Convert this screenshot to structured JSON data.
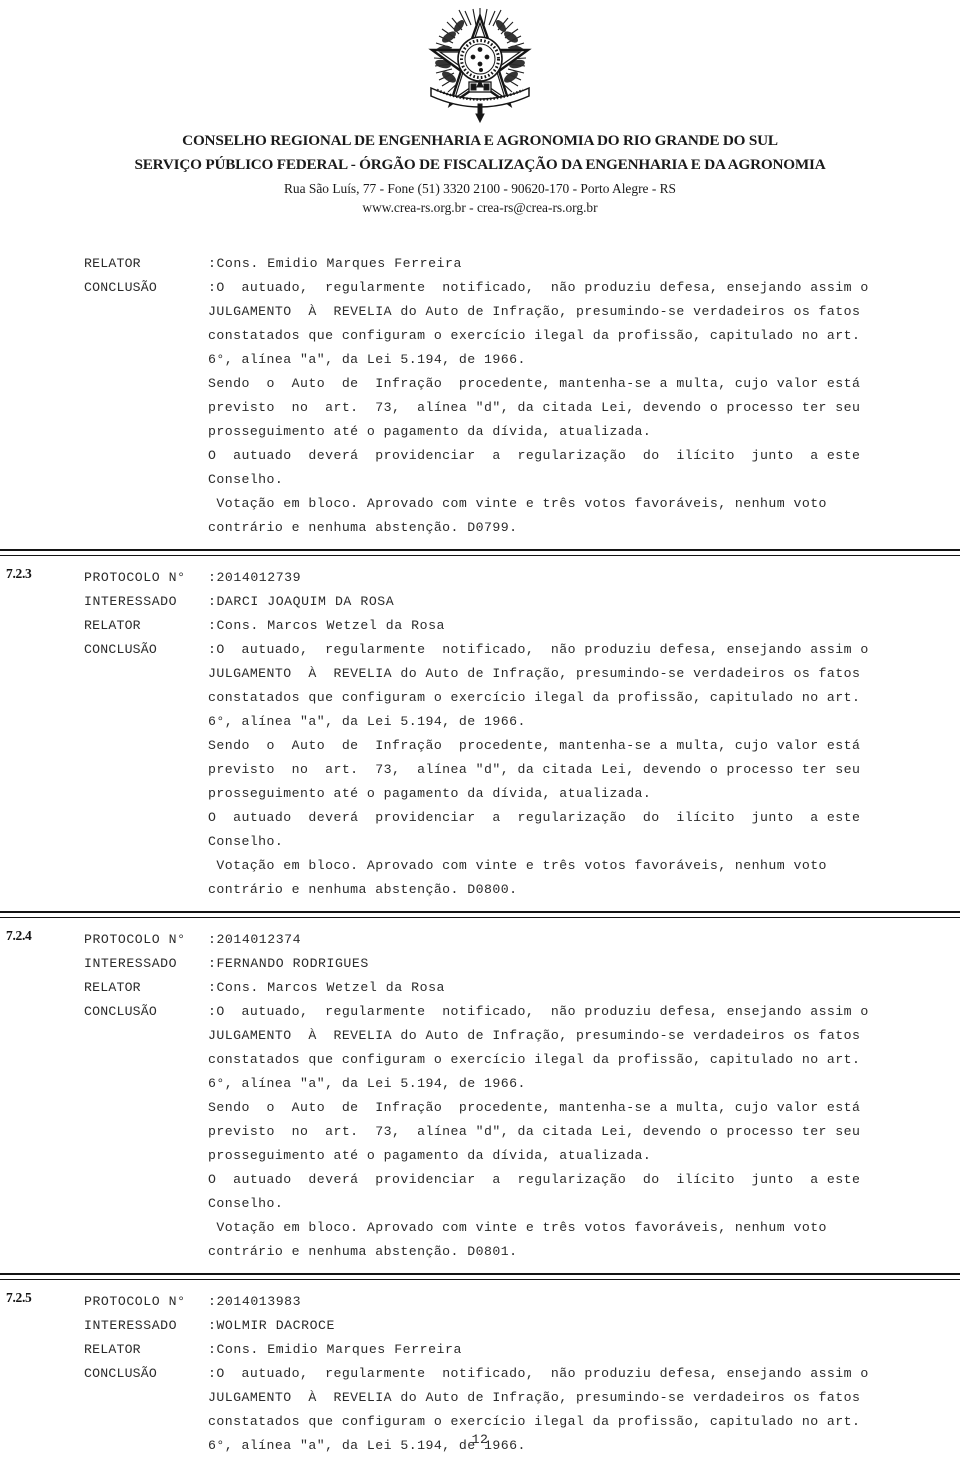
{
  "header": {
    "emblem_name": "brazil-coat-of-arms-emblem",
    "org_line1": "CONSELHO REGIONAL DE ENGENHARIA E AGRONOMIA DO RIO GRANDE DO SUL",
    "org_line2": "SERVIÇO PÚBLICO FEDERAL - ÓRGÃO DE FISCALIZAÇÃO DA ENGENHARIA E DA AGRONOMIA",
    "address": "Rua São Luís, 77 - Fone (51) 3320 2100 - 90620-170 - Porto Alegre - RS",
    "web": "www.crea-rs.org.br - crea-rs@crea-rs.org.br"
  },
  "labels": {
    "protocolo": "PROTOCOLO N°",
    "interessado": "INTERESSADO",
    "relator": "RELATOR",
    "conclusao": "CONCLUSÃO",
    "colon": ":"
  },
  "sections": [
    {
      "number": "",
      "protocolo": "",
      "interessado": "",
      "relator_label": "RELATOR",
      "relator": "Cons. Emidio Marques Ferreira",
      "conclusao_label": "CONCLUSÃO",
      "conclusao_first": "O  autuado,  regularmente  notificado,  não produziu defesa, ensejando assim o",
      "conclusao_lines": [
        "JULGAMENTO  À  REVELIA do Auto de Infração, presumindo-se verdadeiros os fatos",
        "constatados que configuram o exercício ilegal da profissão, capitulado no art.",
        "6°, alínea \"a\", da Lei 5.194, de 1966.",
        "Sendo  o  Auto  de  Infração  procedente, mantenha-se a multa, cujo valor está",
        "previsto  no  art.  73,  alínea \"d\", da citada Lei, devendo o processo ter seu",
        "prosseguimento até o pagamento da dívida, atualizada.",
        "O  autuado  deverá  providenciar  a  regularização  do  ilícito  junto  a este",
        "Conselho.",
        " Votação em bloco. Aprovado com vinte e três votos favoráveis, nenhum voto",
        "contrário e nenhuma abstenção. D0799."
      ]
    },
    {
      "number": "7.2.3",
      "protocolo": "2014012739",
      "interessado": "DARCI JOAQUIM DA ROSA",
      "relator_label": "RELATOR",
      "relator": "Cons. Marcos Wetzel da Rosa",
      "conclusao_label": "CONCLUSÃO",
      "conclusao_first": "O  autuado,  regularmente  notificado,  não produziu defesa, ensejando assim o",
      "conclusao_lines": [
        "JULGAMENTO  À  REVELIA do Auto de Infração, presumindo-se verdadeiros os fatos",
        "constatados que configuram o exercício ilegal da profissão, capitulado no art.",
        "6°, alínea \"a\", da Lei 5.194, de 1966.",
        "Sendo  o  Auto  de  Infração  procedente, mantenha-se a multa, cujo valor está",
        "previsto  no  art.  73,  alínea \"d\", da citada Lei, devendo o processo ter seu",
        "prosseguimento até o pagamento da dívida, atualizada.",
        "O  autuado  deverá  providenciar  a  regularização  do  ilícito  junto  a este",
        "Conselho.",
        " Votação em bloco. Aprovado com vinte e três votos favoráveis, nenhum voto",
        "contrário e nenhuma abstenção. D0800."
      ]
    },
    {
      "number": "7.2.4",
      "protocolo": "2014012374",
      "interessado": "FERNANDO RODRIGUES",
      "relator_label": "RELATOR",
      "relator": "Cons. Marcos Wetzel da Rosa",
      "conclusao_label": "CONCLUSÃO",
      "conclusao_first": "O  autuado,  regularmente  notificado,  não produziu defesa, ensejando assim o",
      "conclusao_lines": [
        "JULGAMENTO  À  REVELIA do Auto de Infração, presumindo-se verdadeiros os fatos",
        "constatados que configuram o exercício ilegal da profissão, capitulado no art.",
        "6°, alínea \"a\", da Lei 5.194, de 1966.",
        "Sendo  o  Auto  de  Infração  procedente, mantenha-se a multa, cujo valor está",
        "previsto  no  art.  73,  alínea \"d\", da citada Lei, devendo o processo ter seu",
        "prosseguimento até o pagamento da dívida, atualizada.",
        "O  autuado  deverá  providenciar  a  regularização  do  ilícito  junto  a este",
        "Conselho.",
        " Votação em bloco. Aprovado com vinte e três votos favoráveis, nenhum voto",
        "contrário e nenhuma abstenção. D0801."
      ]
    },
    {
      "number": "7.2.5",
      "protocolo": "2014013983",
      "interessado": "WOLMIR DACROCE",
      "relator_label": "RELATOR",
      "relator": "Cons. Emidio Marques Ferreira",
      "conclusao_label": "CONCLUSÃO",
      "conclusao_first": "O  autuado,  regularmente  notificado,  não produziu defesa, ensejando assim o",
      "conclusao_lines": [
        "JULGAMENTO  À  REVELIA do Auto de Infração, presumindo-se verdadeiros os fatos",
        "constatados que configuram o exercício ilegal da profissão, capitulado no art.",
        "6°, alínea \"a\", da Lei 5.194, de 1966."
      ]
    }
  ],
  "footer": {
    "page_number": "12"
  }
}
